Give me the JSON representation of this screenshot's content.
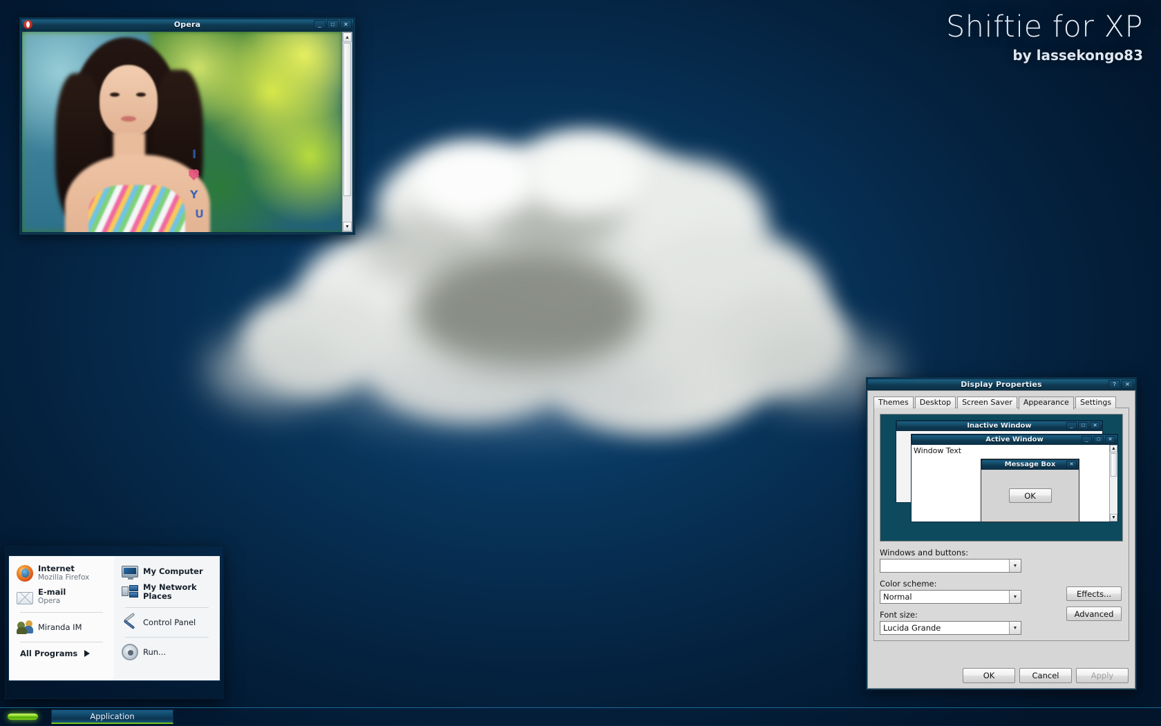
{
  "brand": {
    "title": "Shiftie for XP",
    "author": "by lassekongo83"
  },
  "opera_window": {
    "title": "Opera",
    "icon": "opera-icon",
    "buttons": {
      "minimize": "_",
      "maximize": "□",
      "close": "✕"
    },
    "scrollbar": {
      "up": "▲",
      "down": "▼"
    }
  },
  "display_properties": {
    "title": "Display Properties",
    "titlebar_buttons": {
      "help": "?",
      "close": "✕"
    },
    "tabs": [
      {
        "label": "Themes",
        "active": false
      },
      {
        "label": "Desktop",
        "active": false
      },
      {
        "label": "Screen Saver",
        "active": false
      },
      {
        "label": "Appearance",
        "active": true
      },
      {
        "label": "Settings",
        "active": false
      }
    ],
    "preview": {
      "inactive_window": {
        "title": "Inactive Window",
        "buttons": {
          "minimize": "_",
          "maximize": "□",
          "close": "✕"
        }
      },
      "active_window": {
        "title": "Active Window",
        "buttons": {
          "minimize": "_",
          "maximize": "□",
          "close": "✕"
        },
        "window_text": "Window Text",
        "scroll_up": "▲",
        "scroll_down": "▼"
      },
      "message_box": {
        "title": "Message Box",
        "close": "✕",
        "ok_button": "OK"
      }
    },
    "fields": [
      {
        "label": "Windows and buttons:",
        "value": "",
        "arrow": "▼"
      },
      {
        "label": "Color scheme:",
        "value": "Normal",
        "arrow": "▼"
      },
      {
        "label": "Font size:",
        "value": "Lucida Grande",
        "arrow": "▼"
      }
    ],
    "side_buttons": [
      {
        "label": "Effects...",
        "disabled": false
      },
      {
        "label": "Advanced",
        "disabled": false
      }
    ],
    "bottom_buttons": [
      {
        "label": "OK",
        "disabled": false
      },
      {
        "label": "Cancel",
        "disabled": false
      },
      {
        "label": "Apply",
        "disabled": true
      }
    ]
  },
  "start_menu": {
    "left_items": [
      {
        "name": "Internet",
        "sub": "Mozilla Firefox",
        "icon": "firefox-icon"
      },
      {
        "name": "E-mail",
        "sub": "Opera",
        "icon": "mail-icon"
      },
      {
        "name": "Miranda IM",
        "sub": "",
        "icon": "miranda-icon"
      }
    ],
    "all_programs": {
      "label": "All Programs",
      "arrow": "▶"
    },
    "right_items": [
      {
        "name": "My Computer",
        "icon": "computer-icon"
      },
      {
        "name": "My Network Places",
        "icon": "network-icon"
      },
      {
        "name": "Control Panel",
        "icon": "control-panel-icon"
      },
      {
        "name": "Run...",
        "icon": "run-icon"
      }
    ]
  },
  "taskbar": {
    "start_button": "start-button",
    "items": [
      {
        "label": "Application"
      }
    ]
  }
}
